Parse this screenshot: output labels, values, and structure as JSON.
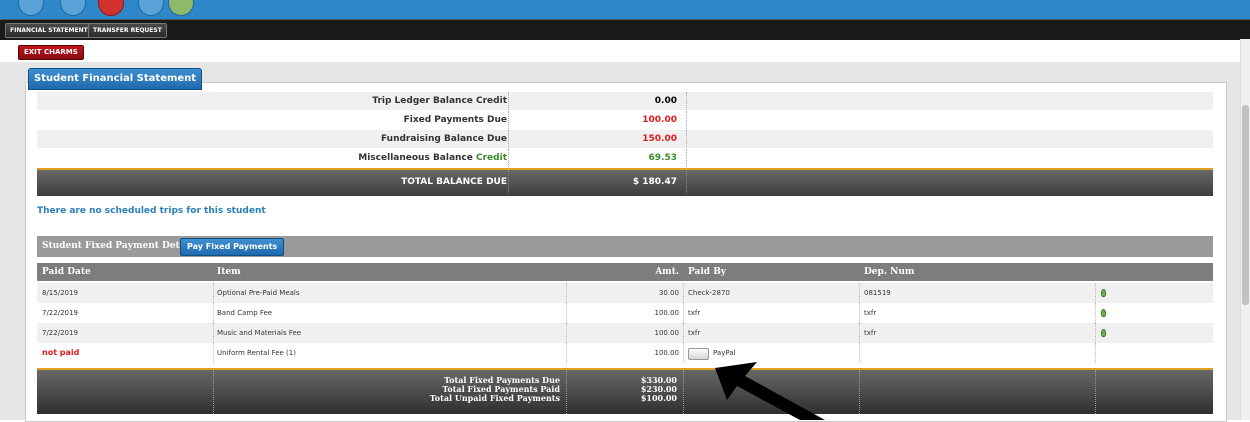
{
  "top_nav": {
    "buttons": [
      "FINANCIAL STATEMENT",
      "TRANSFER REQUEST"
    ],
    "exit_label": "EXIT CHARMS"
  },
  "panel_title": "Student Financial Statement",
  "summary": [
    {
      "label": "Trip Ledger Balance Credit",
      "value": "0.00",
      "color": "#000000"
    },
    {
      "label": "Fixed Payments Due",
      "value": "100.00",
      "color": "#e01b1b"
    },
    {
      "label": "Fundraising Balance Due",
      "value": "150.00",
      "color": "#e01b1b"
    },
    {
      "label": "Miscellaneous Balance",
      "label_suffix": "Credit",
      "value": "69.53",
      "color": "#3a8a2a"
    }
  ],
  "total_balance": {
    "label": "TOTAL BALANCE DUE",
    "value": "$ 180.47"
  },
  "no_trips_message": "There are no scheduled trips for this student",
  "payment_detail": {
    "title": "Student Fixed Payment Detail",
    "pay_button": "Pay Fixed Payments",
    "columns": [
      "Paid Date",
      "Item",
      "Amt.",
      "Paid By",
      "Dep. Num"
    ],
    "rows": [
      {
        "date": "8/15/2019",
        "item": "Optional Pre-Paid Meals",
        "amt": "30.00",
        "paid_by": "Check-2870",
        "dep": "081519"
      },
      {
        "date": "7/22/2019",
        "item": "Band Camp Fee",
        "amt": "100.00",
        "paid_by": "txfr",
        "dep": "txfr"
      },
      {
        "date": "7/22/2019",
        "item": "Music and Materials Fee",
        "amt": "100.00",
        "paid_by": "txfr",
        "dep": "txfr"
      },
      {
        "date": "not paid",
        "item": "Uniform Rental Fee (1)",
        "amt": "100.00",
        "paid_by": "PayPal",
        "dep": ""
      }
    ],
    "totals": {
      "labels": [
        "Total Fixed Payments Due",
        "Total Fixed Payments Paid",
        "Total Unpaid Fixed Payments"
      ],
      "values": [
        "$330.00",
        "$230.00",
        "$100.00"
      ]
    }
  },
  "colors": {
    "accent": "#2e87c8",
    "due": "#e01b1b",
    "credit": "#3a8a2a",
    "exit": "#c0141a"
  }
}
